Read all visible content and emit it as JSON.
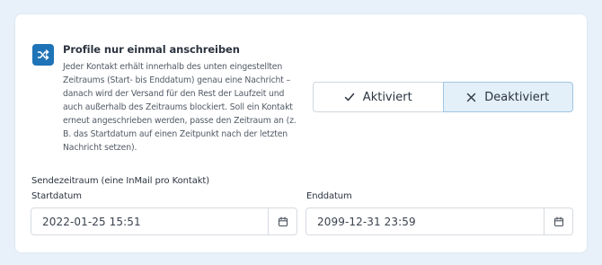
{
  "feature": {
    "icon": "shuffle-icon",
    "title": "Profile nur einmal anschreiben",
    "description": "Jeder Kontakt erhält innerhalb des unten eingestellten Zeitraums (Start- bis Enddatum) genau eine Nachricht – danach wird der Versand für den Rest der Laufzeit und auch außerhalb des Zeitraums blockiert. Soll ein Kontakt erneut angeschrieben werden, passe den Zeitraum an (z. B. das Startdatum auf einen Zeitpunkt nach der letzten Nachricht setzen)."
  },
  "toggle": {
    "active_label": "Aktiviert",
    "inactive_label": "Deaktiviert",
    "selected": "Deaktiviert"
  },
  "schedule": {
    "section_label": "Sendezeitraum (eine InMail pro Kontakt)",
    "start": {
      "label": "Startdatum",
      "value": "2022-01-25 15:51"
    },
    "end": {
      "label": "Enddatum",
      "value": "2099-12-31 23:59"
    }
  },
  "colors": {
    "accent": "#1f73b7",
    "selected_bg": "#e3eff9",
    "page_bg": "#e8f1fa"
  }
}
